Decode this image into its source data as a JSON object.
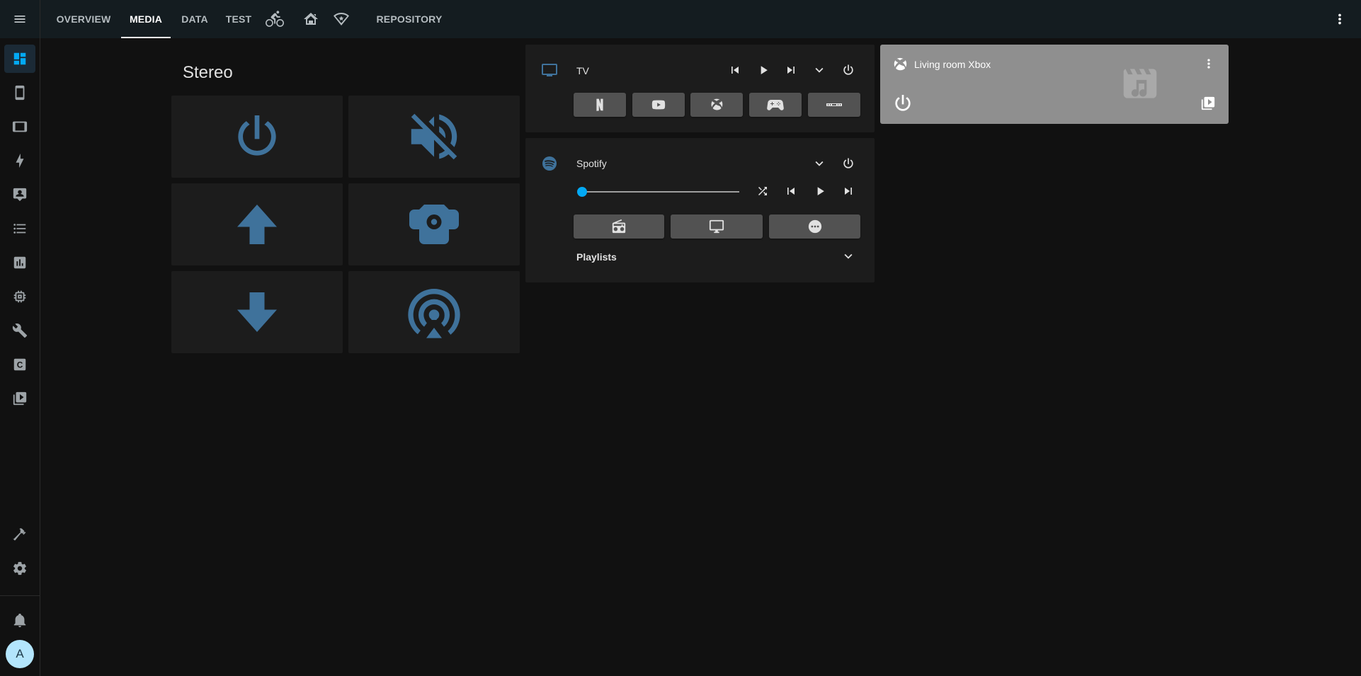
{
  "colors": {
    "accent": "#03a9f4",
    "icon_blue": "#3f729b",
    "topbar_bg": "#141c20",
    "card_bg": "#1c1c1c",
    "xbox_card_bg": "#8f8f8f"
  },
  "sidebar": {
    "menu_icon": "menu-icon",
    "items": [
      {
        "icon": "dashboard-icon",
        "active": true
      },
      {
        "icon": "cellphone-icon"
      },
      {
        "icon": "tablet-icon"
      },
      {
        "icon": "lightning-bolt-icon"
      },
      {
        "icon": "account-box-icon"
      },
      {
        "icon": "format-list-icon"
      },
      {
        "icon": "chart-bar-icon"
      },
      {
        "icon": "memory-chip-icon"
      },
      {
        "icon": "wrench-icon"
      },
      {
        "icon": "c-box-icon"
      },
      {
        "icon": "play-box-multiple-icon"
      }
    ],
    "bottom_items": [
      {
        "icon": "hammer-icon"
      },
      {
        "icon": "cog-icon"
      },
      {
        "icon": "bell-icon"
      }
    ],
    "avatar_initial": "A"
  },
  "topbar": {
    "tabs": [
      {
        "label": "OVERVIEW",
        "active": false
      },
      {
        "label": "MEDIA",
        "active": true
      },
      {
        "label": "DATA",
        "active": false
      },
      {
        "label": "TEST",
        "active": false
      }
    ],
    "icon_tabs": [
      "bike-icon",
      "home-group-icon",
      "wifi-star-icon"
    ],
    "tail_tab": "REPOSITORY",
    "more_icon": "dots-vertical-icon"
  },
  "stereo": {
    "title": "Stereo",
    "buttons": [
      "power-icon",
      "volume-off-icon",
      "arrow-up-icon",
      "speaker-icon",
      "arrow-down-icon",
      "airplay-icon"
    ]
  },
  "tv_card": {
    "title": "TV",
    "icon": "television-icon",
    "controls": [
      "skip-previous-icon",
      "play-icon",
      "skip-next-icon",
      "chevron-down-icon",
      "power-icon"
    ],
    "sources": [
      "netflix-icon",
      "youtube-icon",
      "xbox-icon",
      "gamepad-icon",
      "soundbar-icon"
    ]
  },
  "spotify_card": {
    "title": "Spotify",
    "icon": "spotify-icon",
    "volume": 0.0,
    "controls": [
      "shuffle-icon",
      "skip-previous-icon",
      "play-icon",
      "skip-next-icon"
    ],
    "devices": [
      "radio-icon",
      "monitor-icon",
      "dots-circle-icon"
    ],
    "playlists_label": "Playlists"
  },
  "xbox_card": {
    "title": "Living room Xbox",
    "icon": "xbox-icon",
    "art_icon": "movie-music-icon"
  }
}
